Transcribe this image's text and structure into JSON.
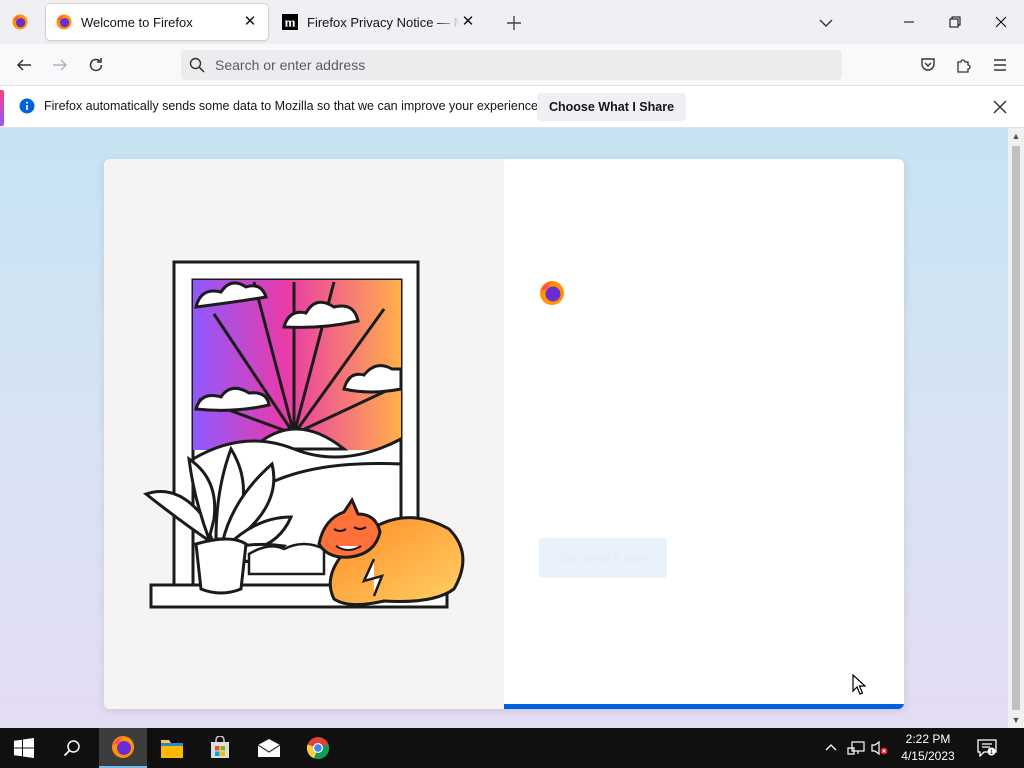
{
  "browser": {
    "tabs": [
      {
        "title": "Welcome to Firefox",
        "active": true,
        "icon": "firefox-icon"
      },
      {
        "title": "Firefox Privacy Notice — Mozilla",
        "active": false,
        "icon": "mozilla-m-icon"
      }
    ],
    "urlbar": {
      "placeholder": "Search or enter address",
      "value": ""
    }
  },
  "notification": {
    "message": "Firefox automatically sends some data to Mozilla so that we can improve your experience.",
    "button_label": "Choose What I Share"
  },
  "onboarding": {
    "primary_button": "See what's new"
  },
  "taskbar": {
    "apps": [
      "start",
      "search",
      "firefox",
      "file-explorer",
      "microsoft-store",
      "mail",
      "chrome"
    ],
    "clock_time": "2:22 PM",
    "clock_date": "4/15/2023"
  },
  "colors": {
    "accent_blue": "#0060df",
    "taskbar": "#101010"
  }
}
